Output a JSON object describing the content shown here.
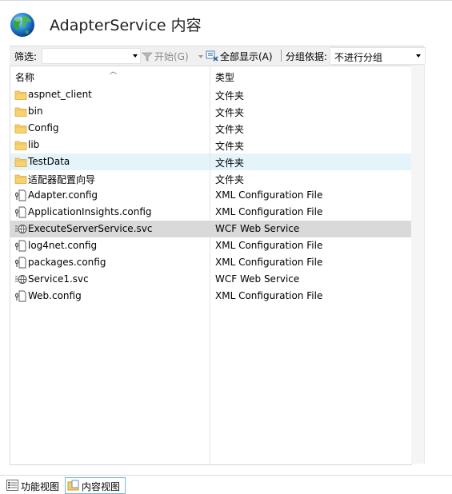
{
  "header": {
    "title": "AdapterService 内容"
  },
  "toolbar": {
    "filter_label": "筛选:",
    "filter_value": "",
    "start_label": "开始(G)",
    "show_all_label": "全部显示(A)",
    "group_label": "分组依据:",
    "group_value": "不进行分组"
  },
  "columns": {
    "name": "名称",
    "type": "类型"
  },
  "rows": [
    {
      "name": "aspnet_client",
      "type": "文件夹",
      "icon": "folder-icon"
    },
    {
      "name": "bin",
      "type": "文件夹",
      "icon": "folder-icon"
    },
    {
      "name": "Config",
      "type": "文件夹",
      "icon": "folder-icon"
    },
    {
      "name": "lib",
      "type": "文件夹",
      "icon": "folder-icon"
    },
    {
      "name": "TestData",
      "type": "文件夹",
      "icon": "folder-icon"
    },
    {
      "name": "适配器配置向导",
      "type": "文件夹",
      "icon": "folder-icon"
    },
    {
      "name": "Adapter.config",
      "type": "XML Configuration File",
      "icon": "config-file-icon"
    },
    {
      "name": "ApplicationInsights.config",
      "type": "XML Configuration File",
      "icon": "config-file-icon"
    },
    {
      "name": "ExecuteServerService.svc",
      "type": "WCF Web Service",
      "icon": "web-service-icon"
    },
    {
      "name": "log4net.config",
      "type": "XML Configuration File",
      "icon": "config-file-icon"
    },
    {
      "name": "packages.config",
      "type": "XML Configuration File",
      "icon": "config-file-icon"
    },
    {
      "name": "Service1.svc",
      "type": "WCF Web Service",
      "icon": "web-service-icon"
    },
    {
      "name": "Web.config",
      "type": "XML Configuration File",
      "icon": "config-file-icon"
    }
  ],
  "bottom_tabs": {
    "features": "功能视图",
    "content": "内容视图"
  },
  "colors": {
    "hover_row": "#e5f3fb",
    "selected_row": "#d9d9d9",
    "accent_border": "#7fb3e5"
  }
}
